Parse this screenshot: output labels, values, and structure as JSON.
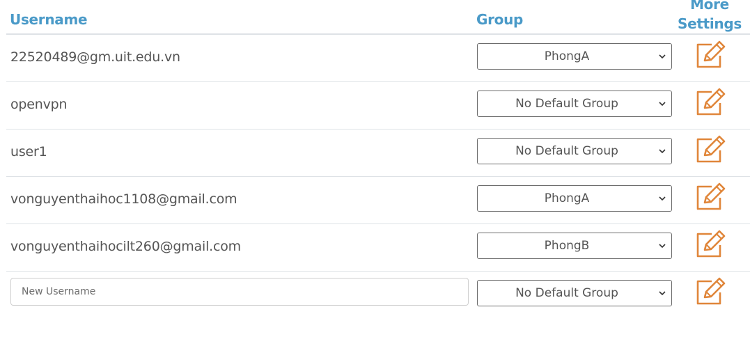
{
  "columns": {
    "username": "Username",
    "group": "Group",
    "more_settings": "More\nSettings"
  },
  "rows": [
    {
      "username": "22520489@gm.uit.edu.vn",
      "group": "PhongA"
    },
    {
      "username": "openvpn",
      "group": "No Default Group"
    },
    {
      "username": "user1",
      "group": "No Default Group"
    },
    {
      "username": "vonguyenthaihoc1108@gmail.com",
      "group": "PhongA"
    },
    {
      "username": "vonguyenthaihocilt260@gmail.com",
      "group": "PhongB"
    }
  ],
  "new_row": {
    "username_value": "",
    "username_placeholder": "New Username",
    "group": "No Default Group"
  },
  "colors": {
    "header_text": "#4a9ac8",
    "edit_icon": "#e0863a",
    "body_text": "#555555"
  },
  "icons": {
    "edit": "edit-square-icon",
    "select_arrow": "chevron-down-icon"
  }
}
